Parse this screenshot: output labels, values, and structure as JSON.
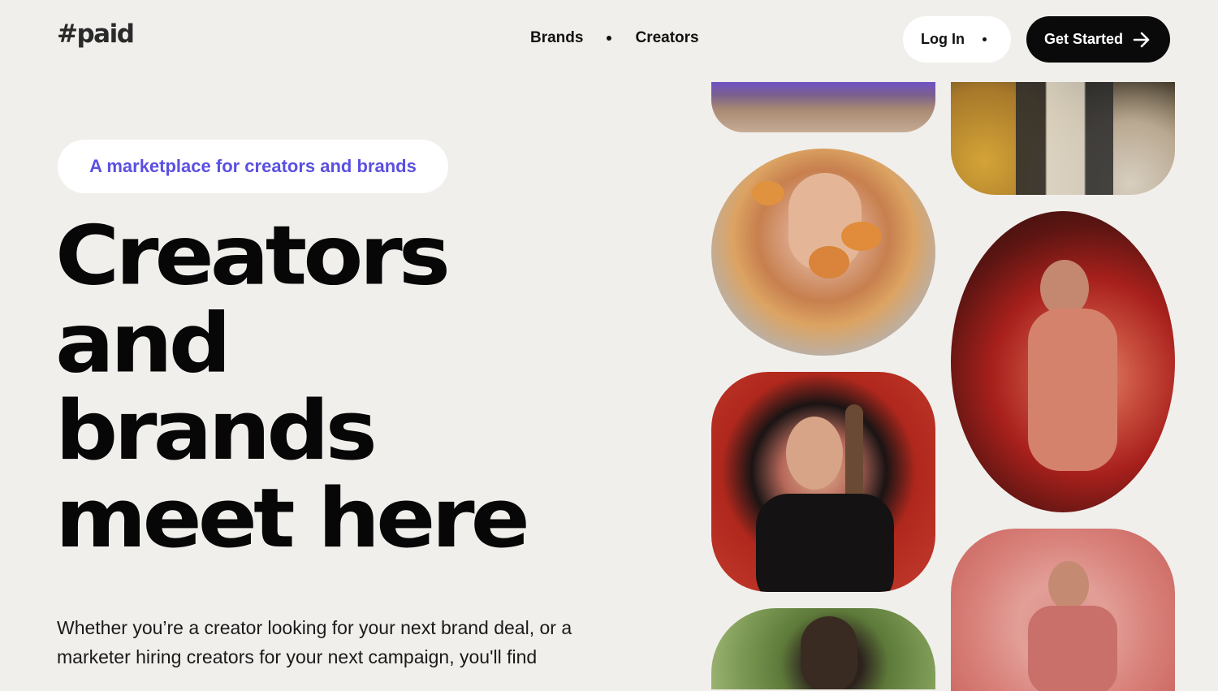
{
  "header": {
    "logo": "#paid",
    "nav": [
      "Brands",
      "Creators"
    ],
    "login_label": "Log In",
    "get_started_label": "Get Started"
  },
  "hero": {
    "badge": "A marketplace for creators and brands",
    "headline": [
      "Creators",
      "and",
      "brands",
      "meet here"
    ],
    "subtext_lines": [
      "Whether you’re a creator looking for your next brand deal, or a",
      "marketer hiring creators for your next campaign, you'll find"
    ]
  },
  "colors": {
    "background": "#f1efeb",
    "accent": "#5b50e0",
    "primary_button": "#0a0a0a"
  },
  "icons": {
    "get_started": "arrow-right-icon",
    "nav_separator": "dot-icon"
  }
}
